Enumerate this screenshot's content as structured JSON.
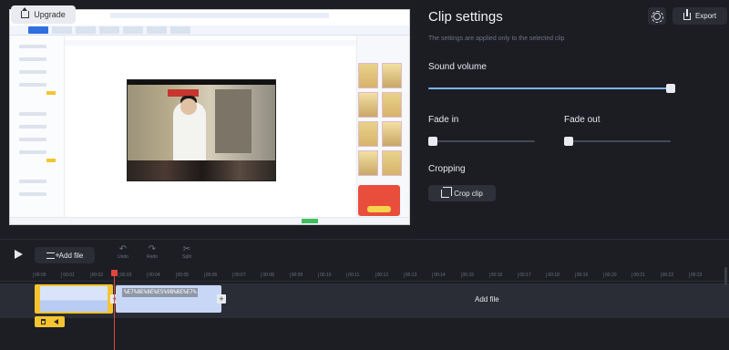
{
  "preview": {
    "upgrade_label": "Upgrade"
  },
  "settings": {
    "title": "Clip settings",
    "subtitle": "The settings are applied only to the selected clip",
    "export_label": "Export",
    "sound_volume_label": "Sound volume",
    "sound_volume_value": 1.0,
    "fade_in_label": "Fade in",
    "fade_in_value": 0.0,
    "fade_out_label": "Fade out",
    "fade_out_value": 0.0,
    "cropping_label": "Cropping",
    "crop_button_label": "Crop clip"
  },
  "timeline": {
    "add_file_label": "Add file",
    "tools": [
      {
        "label": "Undo",
        "icon": "undo-icon"
      },
      {
        "label": "Redo",
        "icon": "redo-icon"
      },
      {
        "label": "Split",
        "icon": "scissors-icon"
      }
    ],
    "ticks": [
      "00:00",
      "00:01",
      "00:02",
      "00:03",
      "00:04",
      "00:05",
      "00:06",
      "00:07",
      "00:08",
      "00:09",
      "00:10",
      "00:11",
      "00:12",
      "00:13",
      "00:14",
      "00:15",
      "00:16",
      "00:17",
      "00:18",
      "00:19",
      "00:20",
      "00:21",
      "00:22",
      "00:23"
    ],
    "clip2_name": "%E7%8E%8E%E5%9B%BE%E7%",
    "track_add_file_label": "Add file"
  },
  "colors": {
    "accent": "#7fb3ff",
    "clip_highlight": "#f5c430",
    "playhead": "#e2453c"
  }
}
